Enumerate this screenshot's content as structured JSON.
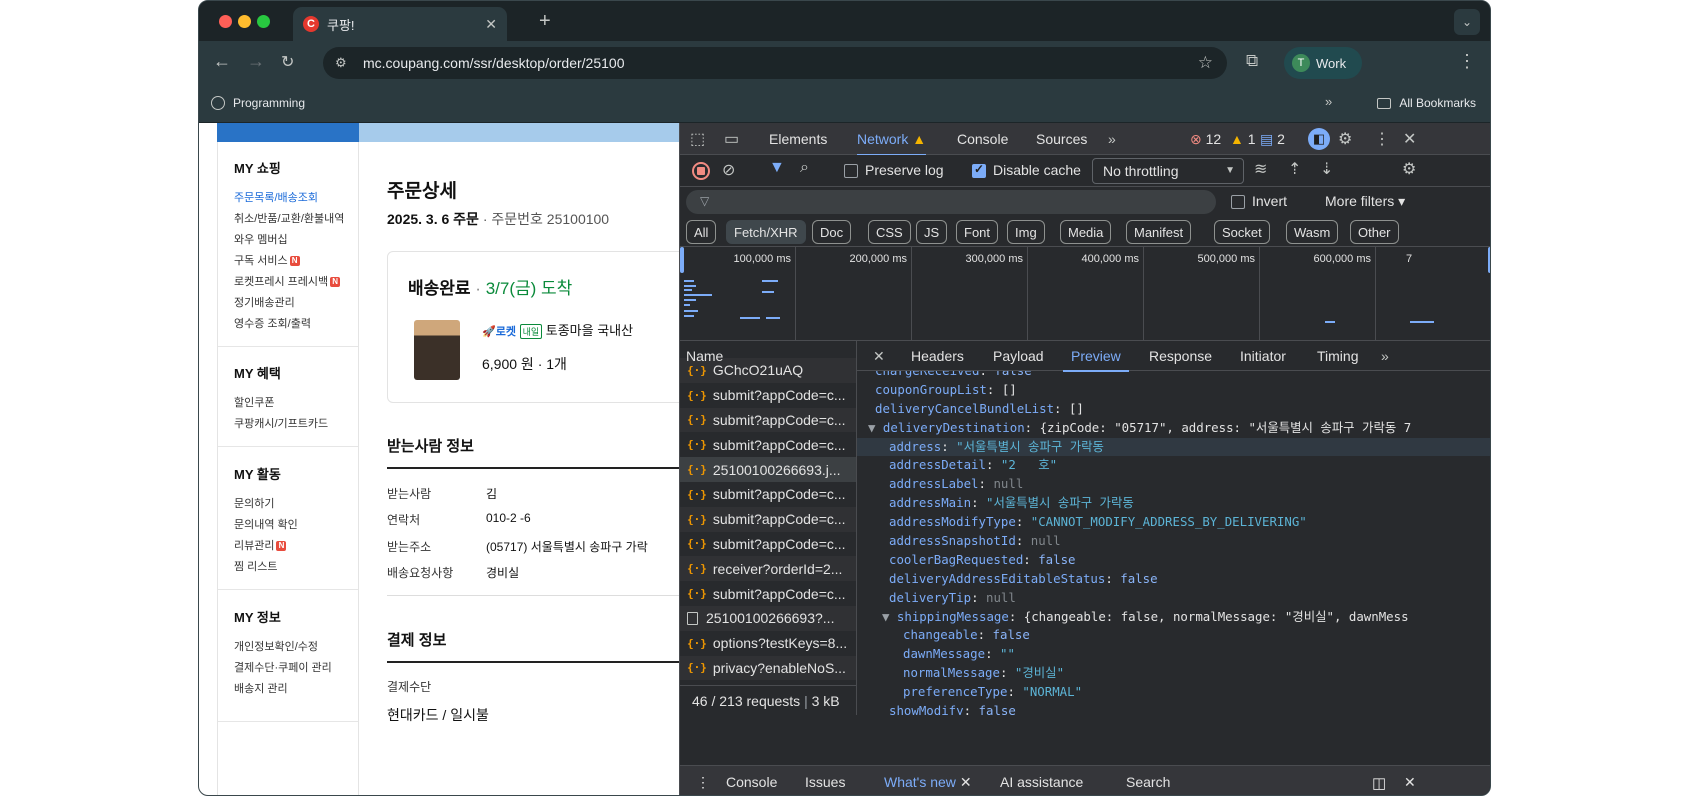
{
  "browser": {
    "tab_title": "쿠팡!",
    "tab_favicon": "C",
    "url": "mc.coupang.com/ssr/desktop/order/25100",
    "profile_initial": "T",
    "profile_name": "Work",
    "bookmark": "Programming",
    "all_bookmarks": "All Bookmarks"
  },
  "sidebar": {
    "sections": [
      {
        "title": "MY 쇼핑",
        "items": [
          "주문목록/배송조회",
          "취소/반품/교환/환불내역",
          "와우 멤버십",
          "구독 서비스",
          "로켓프레시 프레시백",
          "정기배송관리",
          "영수증 조회/출력"
        ]
      },
      {
        "title": "MY 혜택",
        "items": [
          "할인쿠폰",
          "쿠팡캐시/기프트카드"
        ]
      },
      {
        "title": "MY 활동",
        "items": [
          "문의하기",
          "문의내역 확인",
          "리뷰관리",
          "찜 리스트"
        ]
      },
      {
        "title": "MY 정보",
        "items": [
          "개인정보확인/수정",
          "결제수단·쿠페이 관리",
          "배송지 관리"
        ]
      }
    ],
    "new_badge": "N"
  },
  "order": {
    "title": "주문상세",
    "date": "2025. 3. 6 주문",
    "sep": "·",
    "number": "주문번호 25100100",
    "status": "배송완료",
    "arrival": "3/7(금) 도착",
    "rocket": "🚀로켓",
    "tomorrow": "내일",
    "product": "토종마을 국내산",
    "price": "6,900 원 · 1개",
    "recipient_heading": "받는사람 정보",
    "recipient_rows": [
      {
        "label": "받는사람",
        "value": "김"
      },
      {
        "label": "연락처",
        "value": "010-2     -6"
      },
      {
        "label": "받는주소",
        "value": "(05717) 서울특별시 송파구 가락"
      },
      {
        "label": "배송요청사항",
        "value": "경비실"
      }
    ],
    "payment_heading": "결제 정보",
    "payment_label": "결제수단",
    "payment_value": "현대카드 / 일시불"
  },
  "devtools": {
    "tabs": [
      "Elements",
      "Network",
      "Console",
      "Sources"
    ],
    "errors": "12",
    "warnings": "1",
    "messages": "2",
    "preserve_log": "Preserve log",
    "disable_cache": "Disable cache",
    "throttling": "No throttling",
    "invert": "Invert",
    "more_filters": "More filters",
    "filter_chips": [
      "All",
      "Fetch/XHR",
      "Doc",
      "CSS",
      "JS",
      "Font",
      "Img",
      "Media",
      "Manifest",
      "Socket",
      "Wasm",
      "Other"
    ],
    "timeline_ticks": [
      "100,000 ms",
      "200,000 ms",
      "300,000 ms",
      "400,000 ms",
      "500,000 ms",
      "600,000 ms",
      "7"
    ],
    "name_header": "Name",
    "requests": [
      {
        "name": "GChcO21uAQ",
        "kind": "js"
      },
      {
        "name": "submit?appCode=c...",
        "kind": "js"
      },
      {
        "name": "submit?appCode=c...",
        "kind": "js"
      },
      {
        "name": "submit?appCode=c...",
        "kind": "js"
      },
      {
        "name": "25100100266693.j...",
        "kind": "js"
      },
      {
        "name": "submit?appCode=c...",
        "kind": "js"
      },
      {
        "name": "submit?appCode=c...",
        "kind": "js"
      },
      {
        "name": "submit?appCode=c...",
        "kind": "js"
      },
      {
        "name": "receiver?orderId=2...",
        "kind": "js"
      },
      {
        "name": "submit?appCode=c...",
        "kind": "js"
      },
      {
        "name": "25100100266693?...",
        "kind": "doc"
      },
      {
        "name": "options?testKeys=8...",
        "kind": "js"
      },
      {
        "name": "privacy?enableNoS...",
        "kind": "js"
      }
    ],
    "footer": "46 / 213 requests",
    "footer_size": "3 kB",
    "detail_tabs": [
      "Headers",
      "Payload",
      "Preview",
      "Response",
      "Initiator",
      "Timing"
    ],
    "preview_lines": [
      "chargeReceived: false",
      "couponGroupList: []",
      "deliveryCancelBundleList: []",
      "▼ deliveryDestination: {zipCode: \"05717\", address: \"서울특별시 송파구 가락동 7",
      "address: \"서울특별시 송파구 가락동",
      "addressDetail: \"2   호\"",
      "addressLabel: null",
      "addressMain: \"서울특별시 송파구 가락동",
      "addressModifyType: \"CANNOT_MODIFY_ADDRESS_BY_DELIVERING\"",
      "addressSnapshotId: null",
      "coolerBagRequested: false",
      "deliveryAddressEditableStatus: false",
      "deliveryTip: null",
      "▼ shippingMessage: {changeable: false, normalMessage: \"경비실\", dawnMess",
      "changeable: false",
      "dawnMessage: \"\"",
      "normalMessage: \"경비실\"",
      "preferenceType: \"NORMAL\"",
      "showModify: false"
    ],
    "drawer_tabs": [
      "Console",
      "Issues",
      "What's new",
      "AI assistance",
      "Search"
    ]
  }
}
